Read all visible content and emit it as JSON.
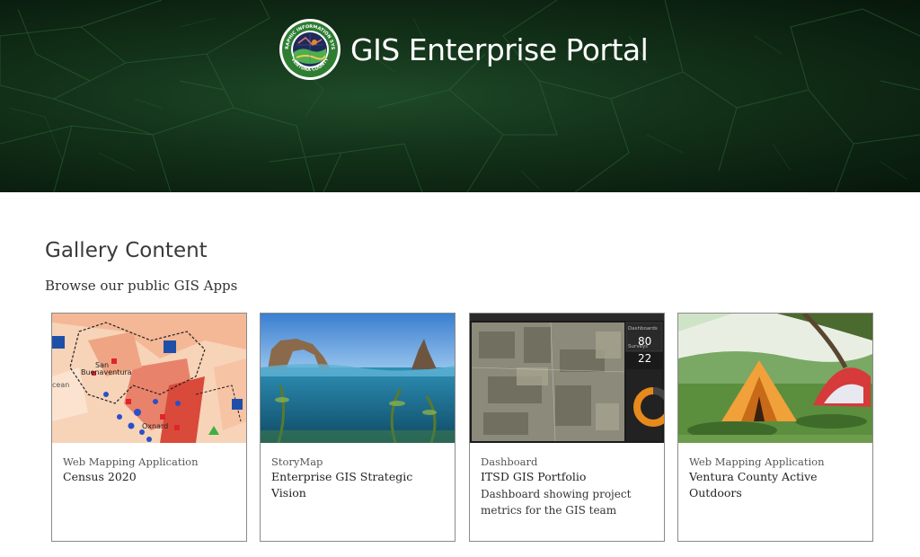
{
  "header": {
    "title": "GIS Enterprise Portal",
    "logo_ring_text": "GEOGRAPHIC INFORMATION SYSTEMS",
    "logo_bottom_text": "VENTURA COUNTY"
  },
  "gallery": {
    "heading": "Gallery Content",
    "subheading": "Browse our public GIS Apps",
    "cards": [
      {
        "type": "Web Mapping Application",
        "title": "Census 2020",
        "description": "",
        "thumb_icon": "census-map-thumbnail"
      },
      {
        "type": "StoryMap",
        "title": "Enterprise GIS Strategic Vision",
        "description": "",
        "thumb_icon": "ocean-arch-photo"
      },
      {
        "type": "Dashboard",
        "title": "ITSD GIS Portfolio",
        "description": "Dashboard showing project metrics for the GIS team",
        "thumb_icon": "dashboard-thumbnail"
      },
      {
        "type": "Web Mapping Application",
        "title": "Ventura County Active Outdoors",
        "description": "",
        "thumb_icon": "camping-tent-photo"
      }
    ],
    "dashboard_thumb": {
      "label_1": "Dashboards",
      "value_1": "80",
      "label_2": "Surveys",
      "value_2": "22"
    },
    "census_thumb": {
      "label_1": "San",
      "label_2": "Buenaventura",
      "label_3": "Oxnard",
      "label_4": "cean"
    }
  },
  "colors": {
    "banner_dark": "#07170b",
    "banner_green": "#1e4a28",
    "seal_green": "#2e7d32",
    "accent_orange": "#e8891c"
  }
}
